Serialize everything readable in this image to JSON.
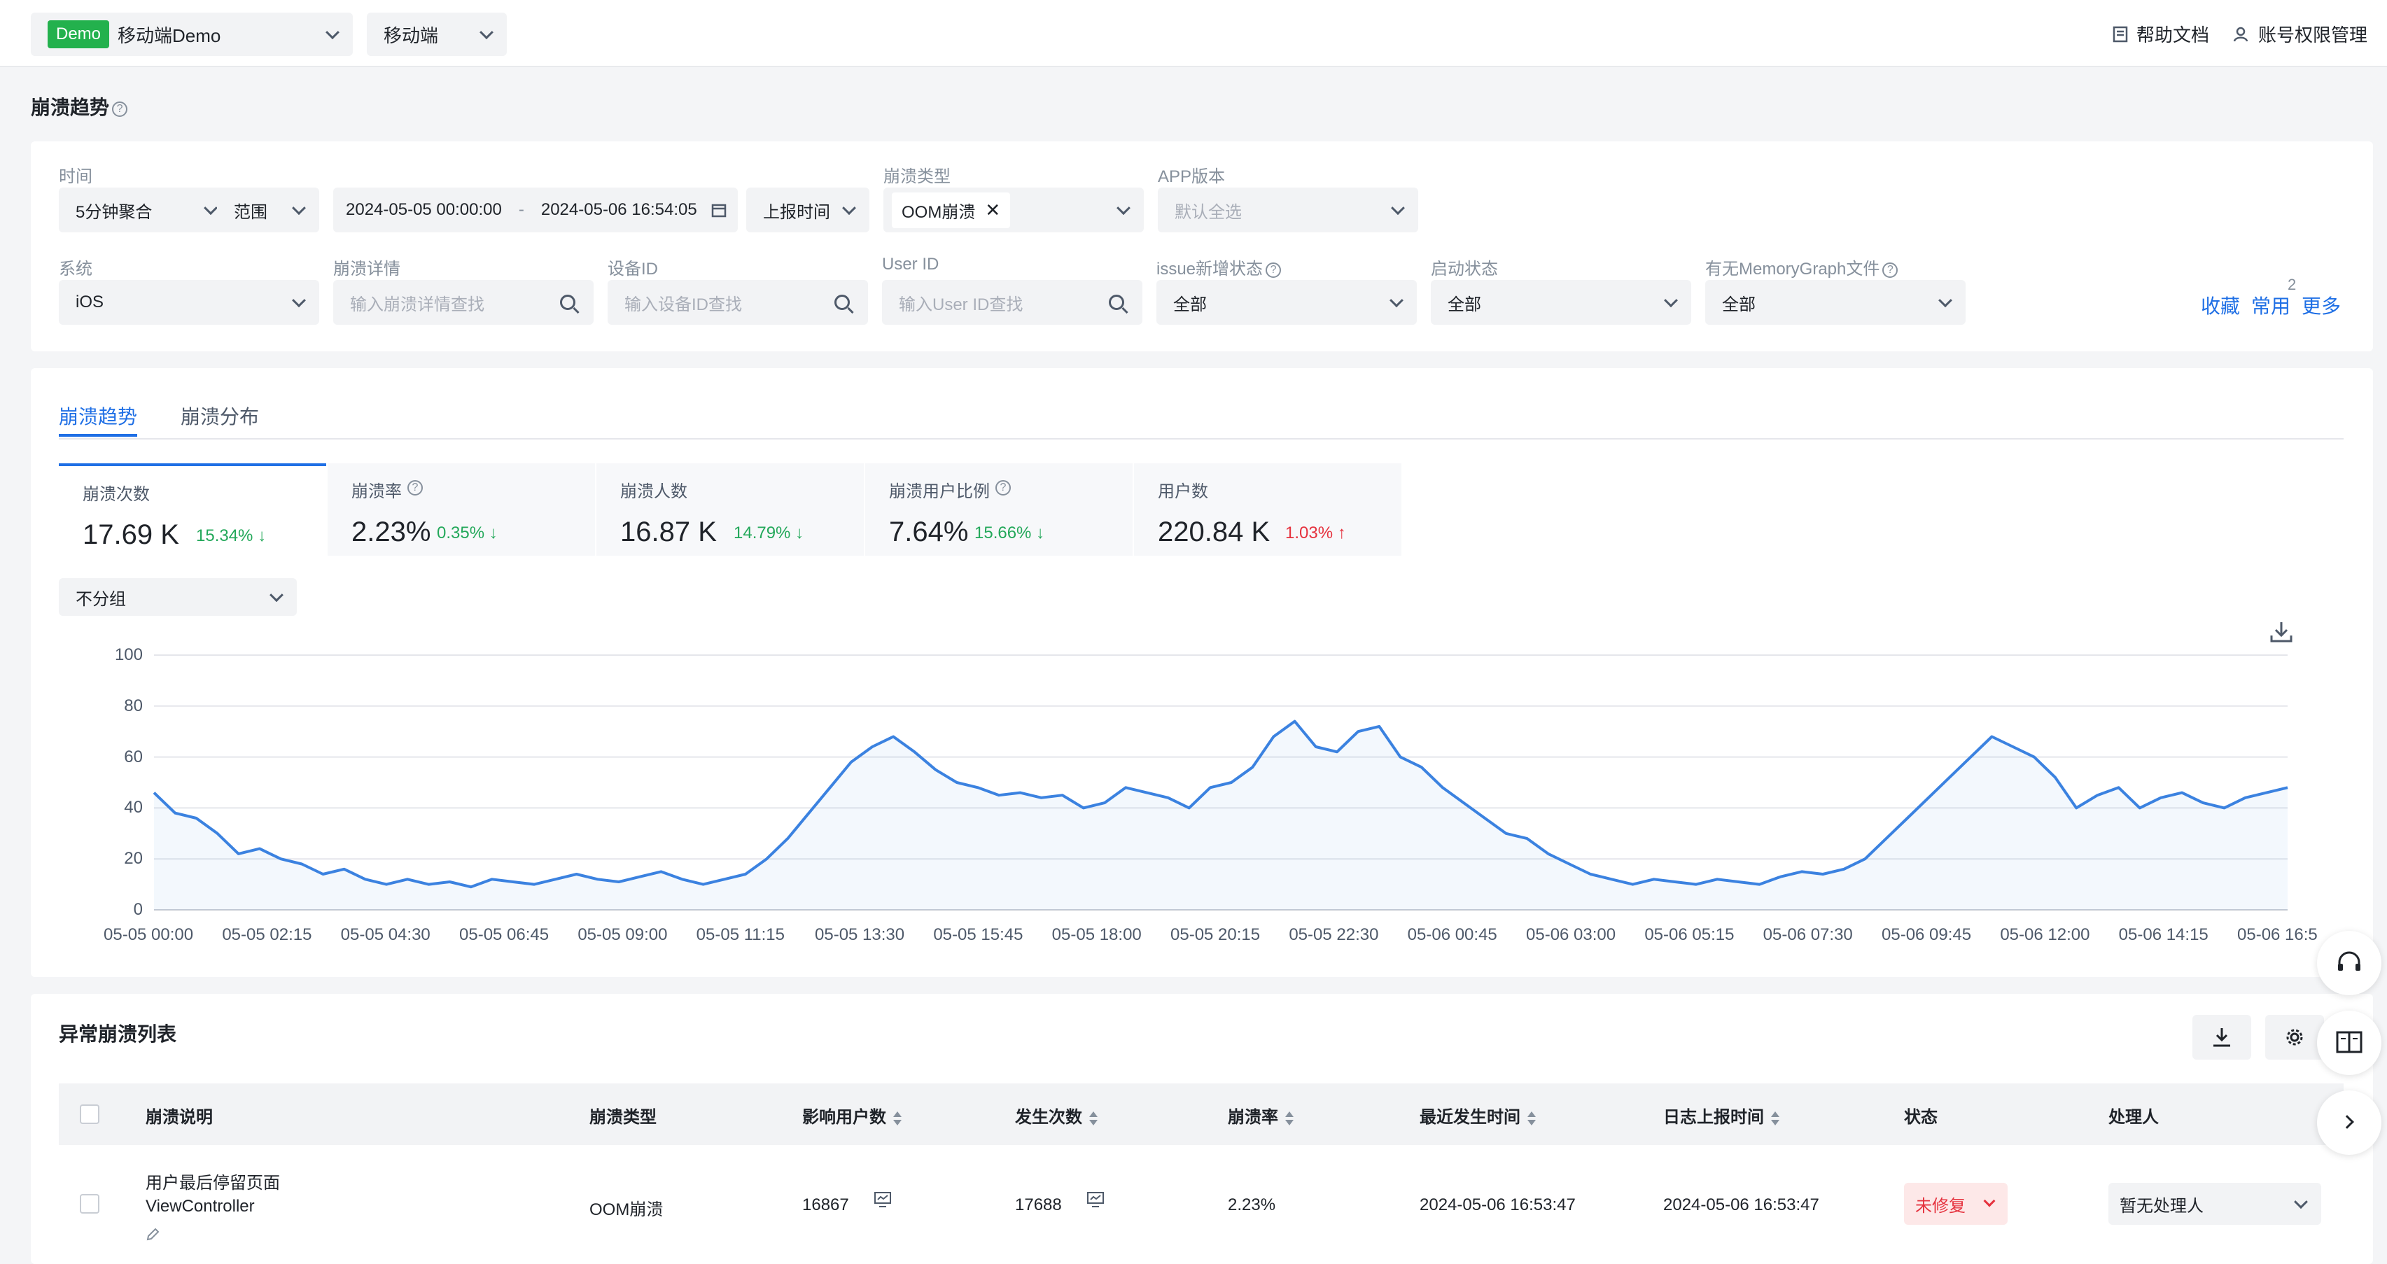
{
  "topbar": {
    "badge": "Demo",
    "app_name": "移动端Demo",
    "platform": "移动端",
    "help_docs": "帮助文档",
    "account_mgmt": "账号权限管理"
  },
  "page_title": "崩溃趋势",
  "filters": {
    "time_label": "时间",
    "aggregation": "5分钟聚合",
    "range": "范围",
    "date_start": "2024-05-05 00:00:00",
    "date_sep": "-",
    "date_end": "2024-05-06 16:54:05",
    "report_time": "上报时间",
    "crash_type_label": "崩溃类型",
    "crash_type_tag": "OOM崩溃",
    "app_version_label": "APP版本",
    "app_version_placeholder": "默认全选",
    "system_label": "系统",
    "system_value": "iOS",
    "crash_detail_label": "崩溃详情",
    "crash_detail_placeholder": "输入崩溃详情查找",
    "device_id_label": "设备ID",
    "device_id_placeholder": "输入设备ID查找",
    "user_id_label": "User ID",
    "user_id_placeholder": "输入User ID查找",
    "issue_status_label": "issue新增状态",
    "issue_status_value": "全部",
    "launch_status_label": "启动状态",
    "launch_status_value": "全部",
    "memgraph_label": "有无MemoryGraph文件",
    "memgraph_value": "全部",
    "favorite": "收藏",
    "common": "常用",
    "common_count": "2",
    "more": "更多"
  },
  "tabs": [
    "崩溃趋势",
    "崩溃分布"
  ],
  "metrics": [
    {
      "label": "崩溃次数",
      "value": "17.69 K",
      "change": "15.34%",
      "dir": "down",
      "help": false
    },
    {
      "label": "崩溃率",
      "value": "2.23%",
      "change": "0.35%",
      "dir": "down",
      "help": true
    },
    {
      "label": "崩溃人数",
      "value": "16.87 K",
      "change": "14.79%",
      "dir": "down",
      "help": false
    },
    {
      "label": "崩溃用户比例",
      "value": "7.64%",
      "change": "15.66%",
      "dir": "down",
      "help": true
    },
    {
      "label": "用户数",
      "value": "220.84 K",
      "change": "1.03%",
      "dir": "up",
      "help": false
    }
  ],
  "group_select": "不分组",
  "chart_data": {
    "type": "line",
    "ylim": [
      0,
      100
    ],
    "yticks": [
      0,
      20,
      40,
      60,
      80,
      100
    ],
    "xticks": [
      "05-05 00:00",
      "05-05 02:15",
      "05-05 04:30",
      "05-05 06:45",
      "05-05 09:00",
      "05-05 11:15",
      "05-05 13:30",
      "05-05 15:45",
      "05-05 18:00",
      "05-05 20:15",
      "05-05 22:30",
      "05-06 00:45",
      "05-06 03:00",
      "05-06 05:15",
      "05-06 07:30",
      "05-06 09:45",
      "05-06 12:00",
      "05-06 14:15",
      "05-06 16:5"
    ],
    "grid": true,
    "color": "#3b82e0",
    "values": [
      46,
      38,
      36,
      30,
      22,
      24,
      20,
      18,
      14,
      16,
      12,
      10,
      12,
      10,
      11,
      9,
      12,
      11,
      10,
      12,
      14,
      12,
      11,
      13,
      15,
      12,
      10,
      12,
      14,
      20,
      28,
      38,
      48,
      58,
      64,
      68,
      62,
      55,
      50,
      48,
      45,
      46,
      44,
      45,
      40,
      42,
      48,
      46,
      44,
      40,
      48,
      50,
      56,
      68,
      74,
      64,
      62,
      70,
      72,
      60,
      56,
      48,
      42,
      36,
      30,
      28,
      22,
      18,
      14,
      12,
      10,
      12,
      11,
      10,
      12,
      11,
      10,
      13,
      15,
      14,
      16,
      20,
      28,
      36,
      44,
      52,
      60,
      68,
      64,
      60,
      52,
      40,
      45,
      48,
      40,
      44,
      46,
      42,
      40,
      44,
      46,
      48
    ],
    "ylabel": "",
    "xlabel": ""
  },
  "list": {
    "title": "异常崩溃列表",
    "columns": [
      "崩溃说明",
      "崩溃类型",
      "影响用户数",
      "发生次数",
      "崩溃率",
      "最近发生时间",
      "日志上报时间",
      "状态",
      "处理人"
    ],
    "rows": [
      {
        "desc_link": "用户最后停留页面",
        "desc_sub": "ViewController",
        "type": "OOM崩溃",
        "users": "16867",
        "count": "17688",
        "rate": "2.23%",
        "last_time": "2024-05-06 16:53:47",
        "report_time": "2024-05-06 16:53:47",
        "status": "未修复",
        "handler": "暂无处理人"
      }
    ]
  }
}
